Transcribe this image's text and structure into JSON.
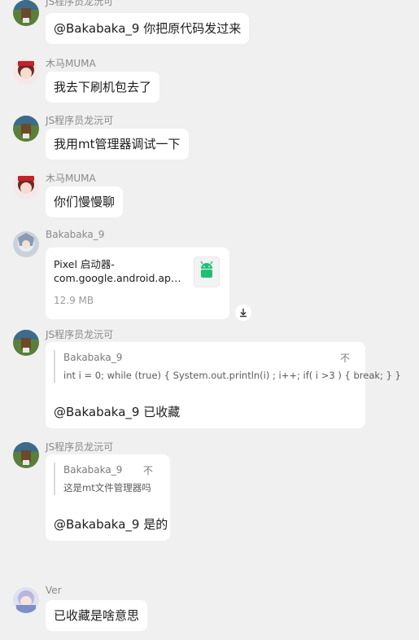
{
  "messages": [
    {
      "sender": "JS程序员龙沅可",
      "text": "@Bakabaka_9 你把原代码发过来"
    },
    {
      "sender": "木马MUMA",
      "text": "我去下刷机包去了"
    },
    {
      "sender": "JS程序员龙沅可",
      "text": "我用mt管理器调试一下"
    },
    {
      "sender": "木马MUMA",
      "text": "你们慢慢聊"
    },
    {
      "sender": "Bakabaka_9",
      "file": {
        "name_line1": "Pixel 启动器-",
        "name_line2": "com.google.android.apps.nexuslauncher",
        "size": "12.9 MB",
        "icon": "android-icon"
      },
      "download_icon": "download-icon"
    },
    {
      "sender": "JS程序员龙沅可",
      "quote": {
        "name": "Bakabaka_9",
        "text": "int i = 0; while (true) { System.out.println(i) ; i++; if( i >3 ) { break; } }",
        "flag": "不"
      },
      "text": "@Bakabaka_9 已收藏"
    },
    {
      "sender": "JS程序员龙沅可",
      "quote": {
        "name": "Bakabaka_9",
        "text": "这是mt文件管理器吗",
        "flag": "不"
      },
      "text": "@Bakabaka_9 是的"
    },
    {
      "sender": "Ver",
      "text": "已收藏是啥意思"
    }
  ],
  "colors": {
    "background": "#f0f0f0",
    "bubble": "#ffffff",
    "sender": "#8a8a8a",
    "android_green": "#1fbf77"
  }
}
